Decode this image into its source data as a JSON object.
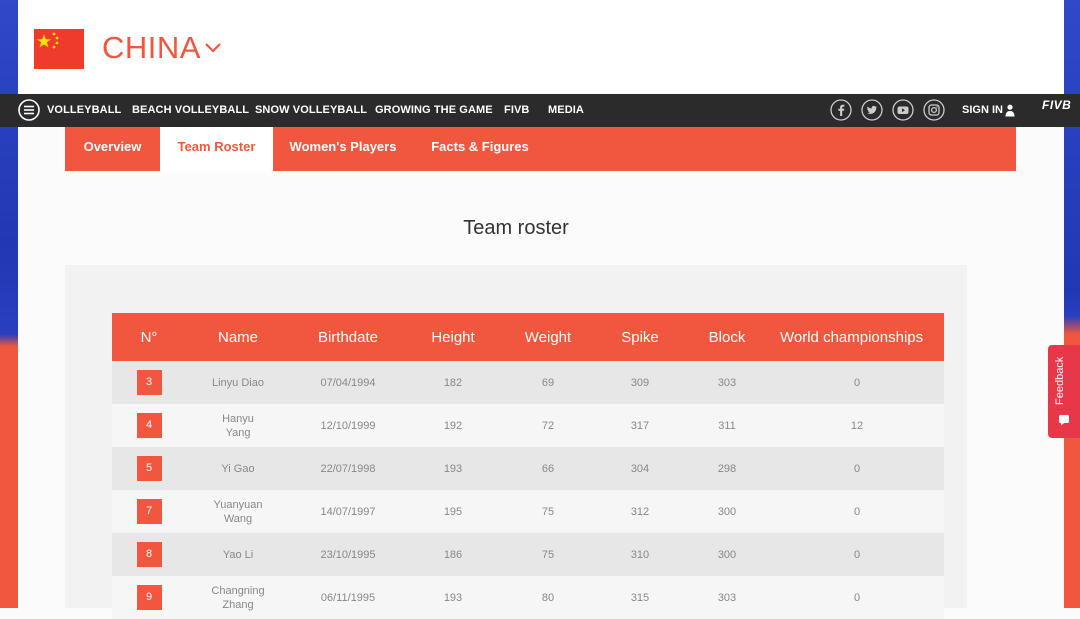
{
  "country": {
    "name": "CHINA",
    "flag_color": "#ee3b2b",
    "flag_star_color": "#ffde00"
  },
  "topnav": {
    "items": [
      "VOLLEYBALL",
      "BEACH VOLLEYBALL",
      "SNOW VOLLEYBALL",
      "GROWING THE GAME",
      "FIVB",
      "MEDIA"
    ],
    "social_icons": [
      "facebook-icon",
      "twitter-icon",
      "youtube-icon",
      "instagram-icon"
    ],
    "sign_in": "SIGN IN",
    "logo": "FIVB"
  },
  "subnav": {
    "tabs": [
      "Overview",
      "Team Roster",
      "Women's Players",
      "Facts & Figures"
    ],
    "active": "Team Roster"
  },
  "section_title": "Team roster",
  "roster": {
    "columns": [
      "N°",
      "Name",
      "Birthdate",
      "Height",
      "Weight",
      "Spike",
      "Block",
      "World championships"
    ],
    "rows": [
      {
        "no": "3",
        "name": [
          "Linyu Diao"
        ],
        "birthdate": "07/04/1994",
        "height": "182",
        "weight": "69",
        "spike": "309",
        "block": "303",
        "wc": "0"
      },
      {
        "no": "4",
        "name": [
          "Hanyu",
          "Yang"
        ],
        "birthdate": "12/10/1999",
        "height": "192",
        "weight": "72",
        "spike": "317",
        "block": "311",
        "wc": "12"
      },
      {
        "no": "5",
        "name": [
          "Yi Gao"
        ],
        "birthdate": "22/07/1998",
        "height": "193",
        "weight": "66",
        "spike": "304",
        "block": "298",
        "wc": "0"
      },
      {
        "no": "7",
        "name": [
          "Yuanyuan",
          "Wang"
        ],
        "birthdate": "14/07/1997",
        "height": "195",
        "weight": "75",
        "spike": "312",
        "block": "300",
        "wc": "0"
      },
      {
        "no": "8",
        "name": [
          "Yao Li"
        ],
        "birthdate": "23/10/1995",
        "height": "186",
        "weight": "75",
        "spike": "310",
        "block": "300",
        "wc": "0"
      },
      {
        "no": "9",
        "name": [
          "Changning",
          "Zhang"
        ],
        "birthdate": "06/11/1995",
        "height": "193",
        "weight": "80",
        "spike": "315",
        "block": "303",
        "wc": "0"
      }
    ]
  },
  "feedback": "Feedback",
  "colors": {
    "accent": "#f1573e",
    "nav_bg": "#2b2b2b",
    "feedback_bg": "#e9374a"
  }
}
